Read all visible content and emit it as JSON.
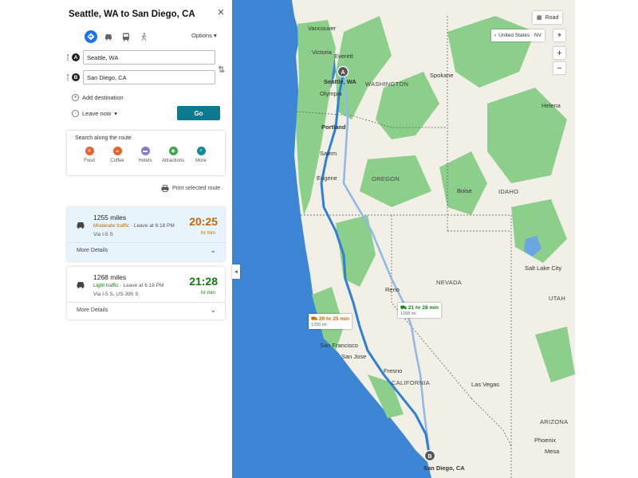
{
  "panel": {
    "title": "Seattle, WA to San Diego, CA",
    "options_label": "Options",
    "waypoint_a": {
      "badge": "A",
      "value": "Seattle, WA"
    },
    "waypoint_b": {
      "badge": "B",
      "value": "San Diego, CA"
    },
    "add_destination": "Add destination",
    "leave_now": "Leave now",
    "go": "Go",
    "search_along": {
      "title": "Search along the route",
      "categories": [
        {
          "label": "Food",
          "icon": "fork-knife-icon",
          "color": "#e8632b"
        },
        {
          "label": "Coffee",
          "icon": "coffee-cup-icon",
          "color": "#e8632b"
        },
        {
          "label": "Hotels",
          "icon": "bed-icon",
          "color": "#8b78d6"
        },
        {
          "label": "Attractions",
          "icon": "camera-icon",
          "color": "#3aa648"
        },
        {
          "label": "More",
          "icon": "search-icon",
          "color": "#13899c"
        }
      ]
    },
    "print_label": "Print selected route",
    "routes": [
      {
        "miles": "1255 miles",
        "traffic": "Moderate traffic",
        "leave": "Leave at 6:18 PM",
        "via": "Via I-5 S",
        "duration": "20:25",
        "unit": "hr min",
        "color": "#c06a00",
        "details": "More Details"
      },
      {
        "miles": "1268 miles",
        "traffic": "Light traffic",
        "leave": "Leave at 6:18 PM",
        "via": "Via I-5 S, US-395 S",
        "duration": "21:28",
        "unit": "hr min",
        "color": "#107c10",
        "details": "More Details"
      }
    ]
  },
  "map": {
    "style_button": "Road",
    "location_label": "United States · NV",
    "zoom_in": "+",
    "zoom_out": "−",
    "callouts": [
      {
        "time": "20 hr 25 min",
        "dist": "1255 mi",
        "color": "#c06a00"
      },
      {
        "time": "21 hr 28 min",
        "dist": "1268 mi",
        "color": "#107c10"
      }
    ],
    "pins": {
      "a": "A",
      "b": "B"
    },
    "labels": {
      "vancouver": "Vancouver",
      "victoria": "Victoria",
      "everett": "Everett",
      "seattle": "Seattle, WA",
      "olympia": "Olympia",
      "washington": "WASHINGTON",
      "spokane": "Spokane",
      "helena": "Helena",
      "portland": "Portland",
      "salem": "Salem",
      "eugene": "Eugene",
      "oregon": "OREGON",
      "boise": "Boise",
      "idaho": "IDAHO",
      "reno": "Reno",
      "nevada": "NEVADA",
      "salt_lake": "Salt Lake City",
      "utah": "UTAH",
      "san_francisco": "San Francisco",
      "san_jose": "San Jose",
      "fresno": "Fresno",
      "california": "CALIFORNIA",
      "las_vegas": "Las Vegas",
      "arizona": "ARIZONA",
      "phoenix": "Phoenix",
      "mesa": "Mesa",
      "san_diego": "San Diego, CA"
    },
    "colors": {
      "water": "#3d86d6",
      "land": "#f2efe6",
      "forest": "#8ccf8a",
      "route_primary": "#2e7fd8",
      "route_alt": "#8db8e8"
    }
  }
}
